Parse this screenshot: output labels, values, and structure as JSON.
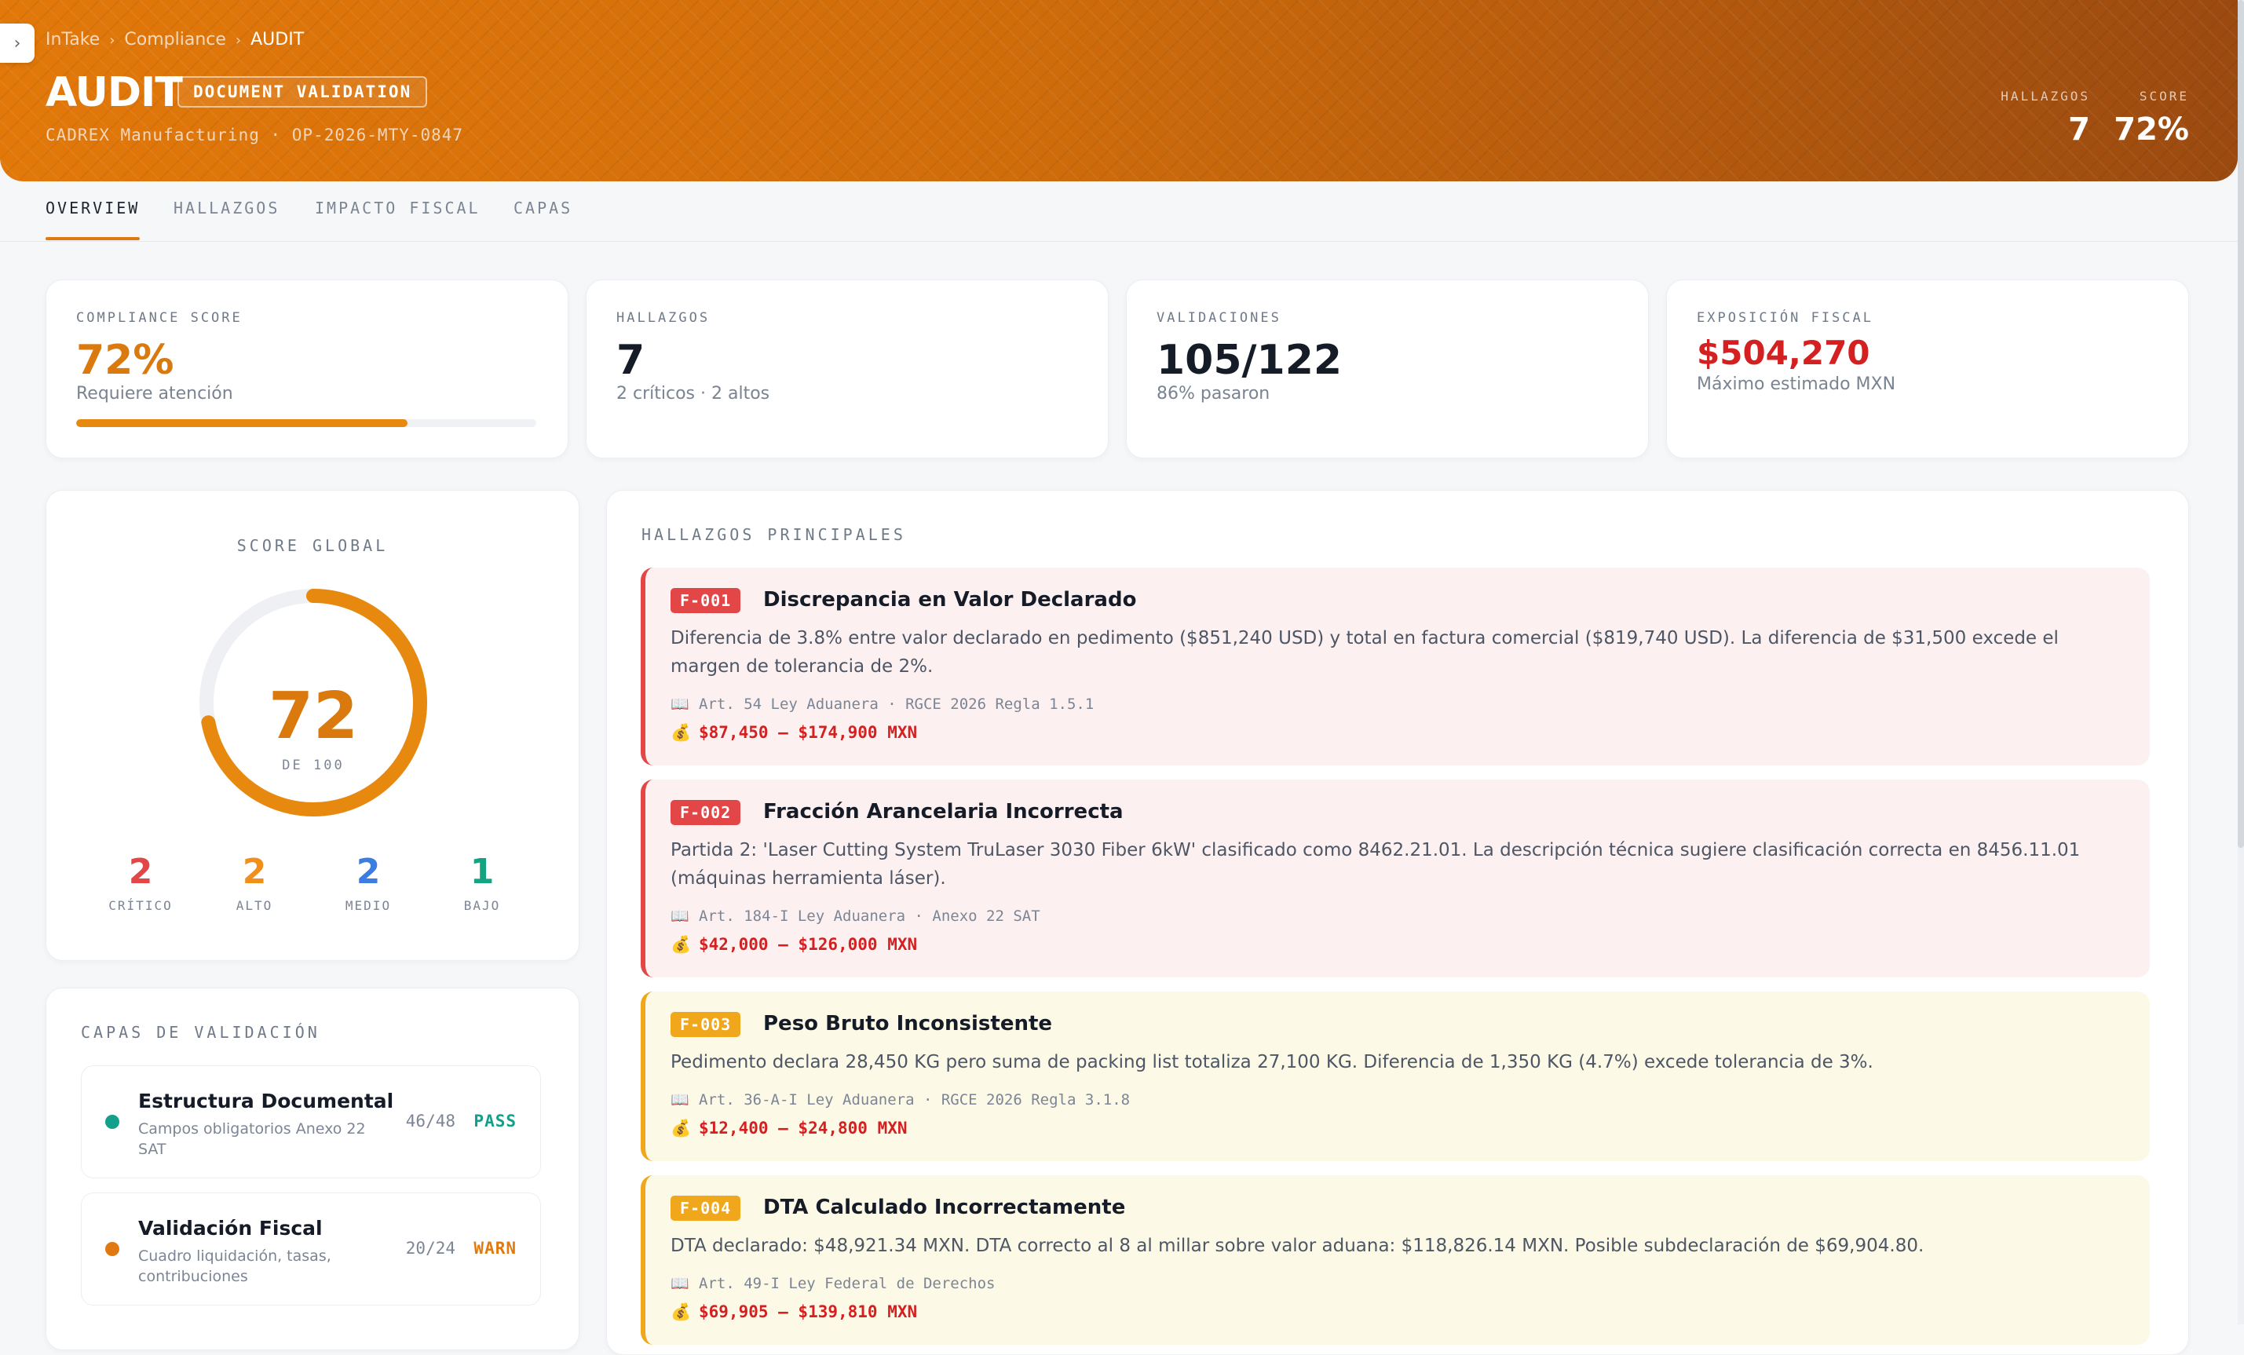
{
  "nav": {
    "toggle_icon": "chevron-right-icon"
  },
  "header": {
    "breadcrumbs": [
      "InTake",
      "Compliance",
      "AUDIT"
    ],
    "title": "AUDIT",
    "badge": "DOCUMENT VALIDATION",
    "subtitle": "CADREX Manufacturing · OP-2026-MTY-0847",
    "stats": [
      {
        "label": "HALLAZGOS",
        "value": "7"
      },
      {
        "label": "SCORE",
        "value": "72%"
      }
    ]
  },
  "tabs": [
    "OVERVIEW",
    "HALLAZGOS",
    "IMPACTO FISCAL",
    "CAPAS"
  ],
  "kpis": {
    "compliance": {
      "label": "COMPLIANCE SCORE",
      "value": "72%",
      "sub": "Requiere atención",
      "progress": 0.72,
      "color": "#d9790e"
    },
    "hallazgos": {
      "label": "HALLAZGOS",
      "value": "7",
      "sub": "2 críticos · 2 altos"
    },
    "validaciones": {
      "label": "VALIDACIONES",
      "value": "105/122",
      "sub": "86% pasaron"
    },
    "exposicion": {
      "label": "EXPOSICIÓN FISCAL",
      "value": "$504,270",
      "sub": "Máximo estimado MXN",
      "color": "#d42020"
    }
  },
  "score_global": {
    "label": "SCORE GLOBAL",
    "value": "72",
    "of": "DE 100",
    "fraction": 0.72,
    "severity": [
      {
        "count": "2",
        "label": "CRÍTICO",
        "color": "#e24646"
      },
      {
        "count": "2",
        "label": "ALTO",
        "color": "#f0901a"
      },
      {
        "count": "2",
        "label": "MEDIO",
        "color": "#3b7de0"
      },
      {
        "count": "1",
        "label": "BAJO",
        "color": "#16a37f"
      }
    ]
  },
  "capas": {
    "label": "CAPAS DE VALIDACIÓN",
    "items": [
      {
        "title": "Estructura Documental",
        "desc": "Campos obligatorios Anexo 22 SAT",
        "count": "46/48",
        "status": "PASS",
        "color": "#13a08a"
      },
      {
        "title": "Validación Fiscal",
        "desc": "Cuadro liquidación, tasas, contribuciones",
        "count": "20/24",
        "status": "WARN",
        "color": "#e07a10"
      }
    ]
  },
  "findings": {
    "label": "HALLAZGOS PRINCIPALES",
    "ref_icon": "book-icon",
    "amount_icon": "money-bag-icon",
    "items": [
      {
        "id": "F-001",
        "level": "crit",
        "title": "Discrepancia en Valor Declarado",
        "desc": "Diferencia de 3.8% entre valor declarado en pedimento ($851,240 USD) y total en factura comercial ($819,740 USD). La diferencia de $31,500 excede el margen de tolerancia de 2%.",
        "ref": "Art. 54 Ley Aduanera · RGCE 2026 Regla 1.5.1",
        "amount": "$87,450 — $174,900 MXN"
      },
      {
        "id": "F-002",
        "level": "crit",
        "title": "Fracción Arancelaria Incorrecta",
        "desc": "Partida 2: 'Laser Cutting System TruLaser 3030 Fiber 6kW' clasificado como 8462.21.01. La descripción técnica sugiere clasificación correcta en 8456.11.01 (máquinas herramienta láser).",
        "ref": "Art. 184-I Ley Aduanera · Anexo 22 SAT",
        "amount": "$42,000 — $126,000 MXN"
      },
      {
        "id": "F-003",
        "level": "warn",
        "title": "Peso Bruto Inconsistente",
        "desc": "Pedimento declara 28,450 KG pero suma de packing list totaliza 27,100 KG. Diferencia de 1,350 KG (4.7%) excede tolerancia de 3%.",
        "ref": "Art. 36-A-I Ley Aduanera · RGCE 2026 Regla 3.1.8",
        "amount": "$12,400 — $24,800 MXN"
      },
      {
        "id": "F-004",
        "level": "warn",
        "title": "DTA Calculado Incorrectamente",
        "desc": "DTA declarado: $48,921.34 MXN. DTA correcto al 8 al millar sobre valor aduana: $118,826.14 MXN. Posible subdeclaración de $69,904.80.",
        "ref": "Art. 49-I Ley Federal de Derechos",
        "amount": "$69,905 — $139,810 MXN"
      }
    ]
  }
}
